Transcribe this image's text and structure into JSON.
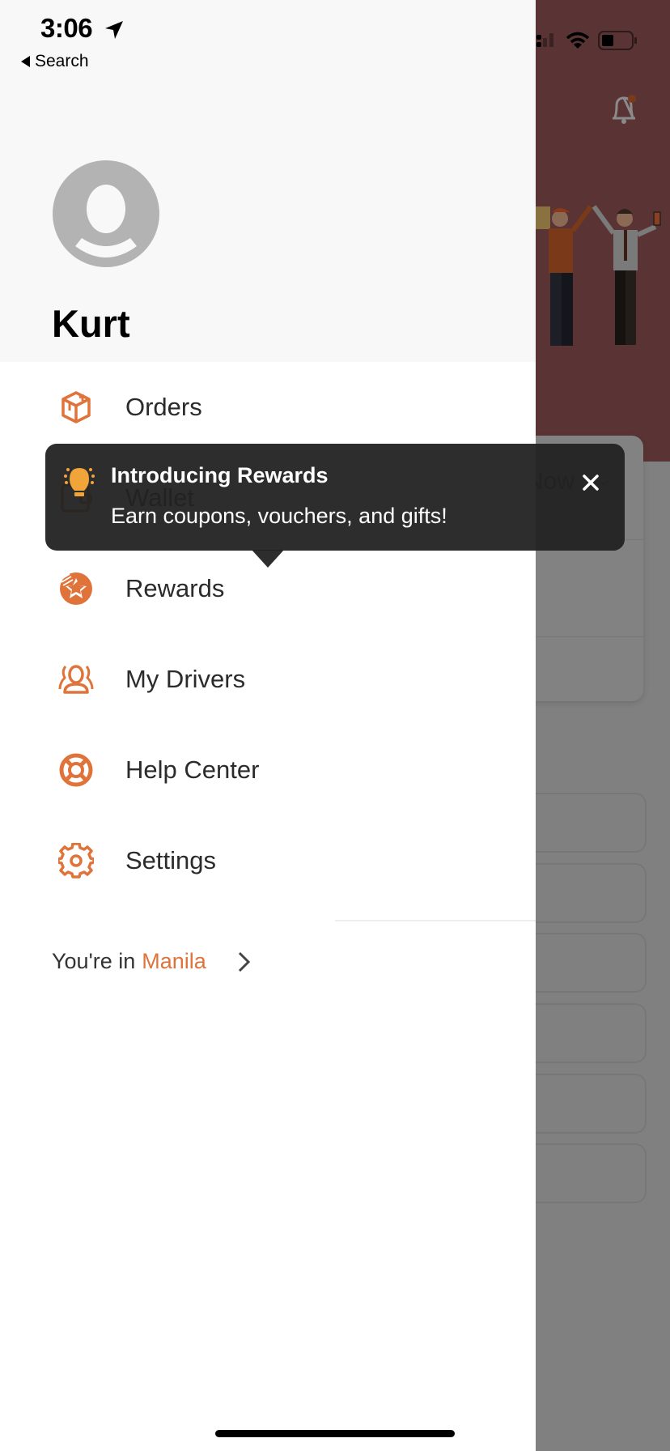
{
  "status_bar": {
    "time": "3:06",
    "back_label": "Search"
  },
  "background": {
    "time_selector": "Now"
  },
  "drawer": {
    "user_name": "Kurt",
    "menu": [
      {
        "label": "Orders",
        "icon": "box-icon"
      },
      {
        "label": "Wallet",
        "icon": "wallet-icon"
      },
      {
        "label": "Rewards",
        "icon": "rewards-star-icon"
      },
      {
        "label": "My Drivers",
        "icon": "drivers-icon"
      },
      {
        "label": "Help Center",
        "icon": "lifebuoy-icon"
      },
      {
        "label": "Settings",
        "icon": "gear-icon"
      }
    ],
    "city_prefix": "You're in",
    "city_name": "Manila"
  },
  "tooltip": {
    "title": "Introducing Rewards",
    "body": "Earn coupons, vouchers, and gifts!"
  },
  "colors": {
    "accent": "#e0733a",
    "bulb": "#f0a43a",
    "tooltip_bg": "#222222",
    "hero_bg": "#5a3434"
  }
}
